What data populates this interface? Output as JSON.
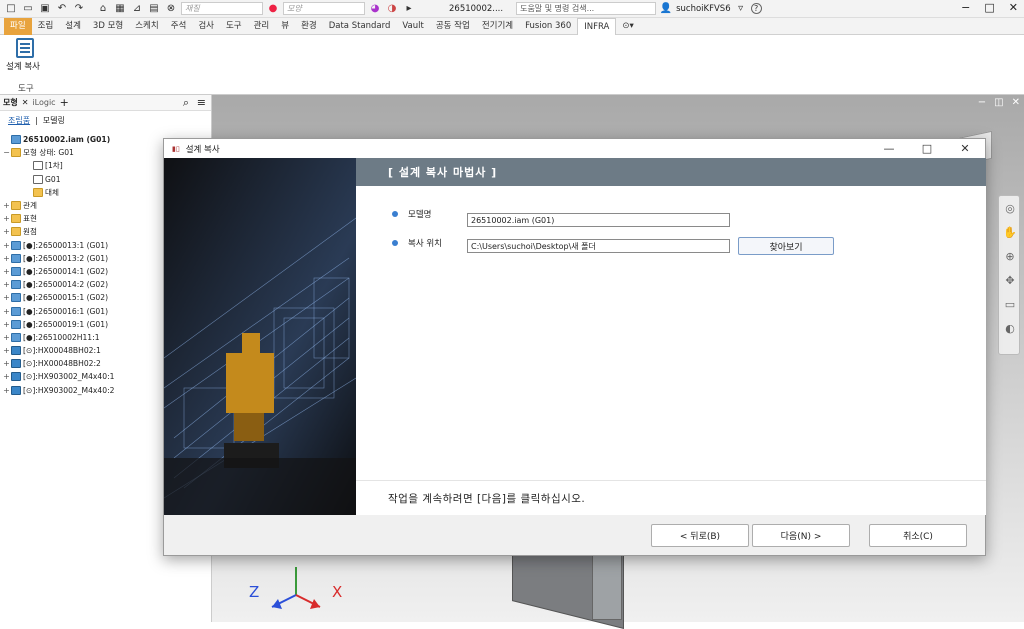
{
  "qat": {
    "appearance_placeholder": "재질",
    "style_placeholder": "모양",
    "doc_title": "26510002....",
    "search_placeholder": "도움말 및 명령 검색...",
    "user": "suchoiKFVS6",
    "help": "?"
  },
  "ribbon": {
    "tabs": [
      "파일",
      "조립",
      "설계",
      "3D 모형",
      "스케치",
      "주석",
      "검사",
      "도구",
      "관리",
      "뷰",
      "환경",
      "Data Standard",
      "Vault",
      "공동 작업",
      "전기기계",
      "Fusion 360",
      "INFRA"
    ],
    "active_tab": "INFRA",
    "panel_button_label": "설계 복사",
    "panel_label": "도구"
  },
  "browser": {
    "tab_model": "모형",
    "tab_logic": "iLogic",
    "view_assembly": "조립품",
    "view_modeling": "모델링",
    "tree": [
      {
        "level": 0,
        "expander": "",
        "icon": "asm",
        "label": "26510002.iam (G01)",
        "bold": true
      },
      {
        "level": 0,
        "expander": "−",
        "icon": "folder",
        "label": "모형 상태: G01"
      },
      {
        "level": 1,
        "expander": "",
        "icon": "rep",
        "label": "[1차]"
      },
      {
        "level": 1,
        "expander": "",
        "icon": "cb",
        "label": "G01"
      },
      {
        "level": 1,
        "expander": "",
        "icon": "folder",
        "label": "대체"
      },
      {
        "level": 0,
        "expander": "+",
        "icon": "folder",
        "label": "관계"
      },
      {
        "level": 0,
        "expander": "+",
        "icon": "folder",
        "label": "표현"
      },
      {
        "level": 0,
        "expander": "+",
        "icon": "folder",
        "label": "원점"
      },
      {
        "level": 0,
        "expander": "+",
        "icon": "asm",
        "label": "[●]:26500013:1 (G01)"
      },
      {
        "level": 0,
        "expander": "+",
        "icon": "asm",
        "label": "[●]:26500013:2 (G01)"
      },
      {
        "level": 0,
        "expander": "+",
        "icon": "asm",
        "label": "[●]:26500014:1 (G02)"
      },
      {
        "level": 0,
        "expander": "+",
        "icon": "asm",
        "label": "[●]:26500014:2 (G02)"
      },
      {
        "level": 0,
        "expander": "+",
        "icon": "asm",
        "label": "[●]:26500015:1 (G02)"
      },
      {
        "level": 0,
        "expander": "+",
        "icon": "asm",
        "label": "[●]:26500016:1 (G01)"
      },
      {
        "level": 0,
        "expander": "+",
        "icon": "asm",
        "label": "[●]:26500019:1 (G01)"
      },
      {
        "level": 0,
        "expander": "+",
        "icon": "asm",
        "label": "[●]:26510002H11:1"
      },
      {
        "level": 0,
        "expander": "+",
        "icon": "part",
        "label": "[⊙]:HX00048BH02:1"
      },
      {
        "level": 0,
        "expander": "+",
        "icon": "part",
        "label": "[⊙]:HX00048BH02:2"
      },
      {
        "level": 0,
        "expander": "+",
        "icon": "part",
        "label": "[⊙]:HX903002_M4x40:1"
      },
      {
        "level": 0,
        "expander": "+",
        "icon": "part",
        "label": "[⊙]:HX903002_M4x40:2"
      }
    ]
  },
  "dialog": {
    "title": "설계 복사",
    "banner": "[ 설계 복사 마법사 ]",
    "model_name_label": "모델명",
    "model_name_value": "26510002.iam (G01)",
    "copy_location_label": "복사 위치",
    "copy_location_value": "C:\\Users\\suchoi\\Desktop\\새 폴더",
    "browse_label": "찾아보기",
    "footer_text": "작업을 계속하려면 [다음]를 클릭하십시오.",
    "back_label": "< 뒤로(B)",
    "next_label": "다음(N) >",
    "cancel_label": "취소(C)"
  },
  "axes": {
    "x": "X",
    "y": "Y",
    "z": "Z"
  },
  "colors": {
    "accent": "#e8a33d",
    "banner": "#6d7b86",
    "bullet": "#3a7fd0"
  }
}
